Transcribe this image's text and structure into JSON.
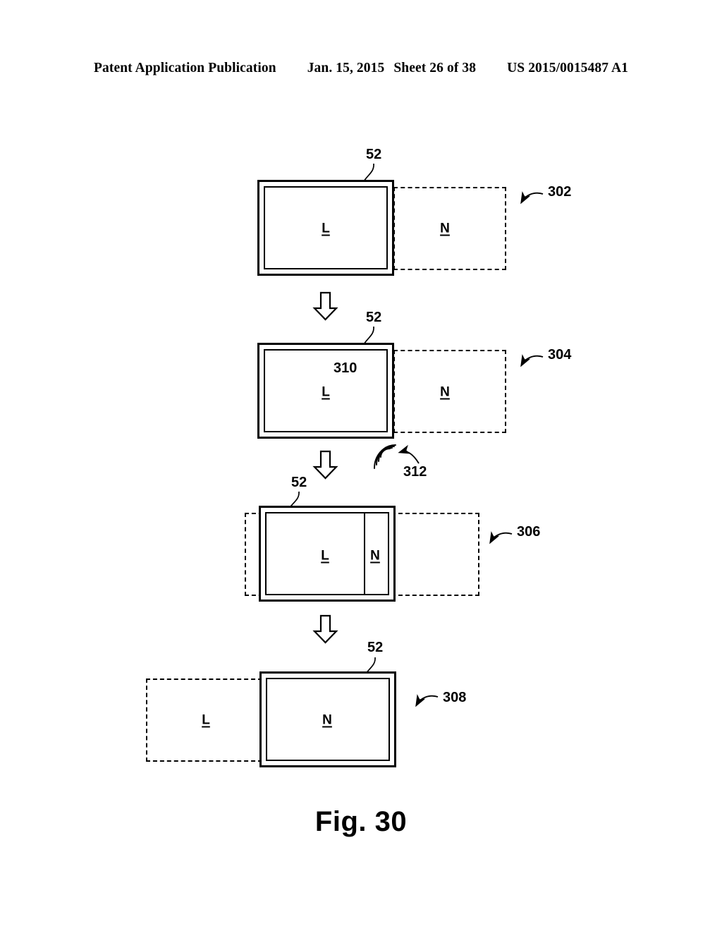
{
  "header": {
    "publication": "Patent Application Publication",
    "date": "Jan. 15, 2015",
    "sheet": "Sheet 26 of 38",
    "patent_number": "US 2015/0015487 A1"
  },
  "figure": {
    "caption": "Fig. 30",
    "device_label": "52",
    "content_primary": "L",
    "content_secondary": "N",
    "colors": {
      "ink": "#000000",
      "paper": "#ffffff"
    }
  },
  "states": [
    {
      "id": "302",
      "label": "302",
      "device_ref": "52",
      "device_content": "L",
      "offscreen_content": "N",
      "offscreen_side": "right",
      "description": "Content L shown on device display; content N resides off-screen to the right"
    },
    {
      "id": "304",
      "label": "304",
      "device_ref": "52",
      "device_content": "L",
      "offscreen_content": "N",
      "offscreen_side": "right",
      "gesture_ref": "310",
      "gesture_label": "310",
      "gesture_icon": "right-block-arrow-icon",
      "signal_ref": "312",
      "signal_label": "312",
      "signal_icon": "wireless-waves-icon",
      "description": "Swipe gesture 310 performed on the display; wireless signal 312 emitted"
    },
    {
      "id": "306",
      "label": "306",
      "device_ref": "52",
      "device_content": "L",
      "strip_content": "N",
      "offscreen_side": "both",
      "description": "Transitional state: content N begins sliding in from the right edge"
    },
    {
      "id": "308",
      "label": "308",
      "device_ref": "52",
      "device_content": "N",
      "offscreen_content": "L",
      "offscreen_side": "left",
      "description": "Content N fully shown on device display; content L now off-screen to the left"
    }
  ],
  "flow_arrows": [
    {
      "name": "transition-302-to-304",
      "direction": "down"
    },
    {
      "name": "transition-304-to-306",
      "direction": "down"
    },
    {
      "name": "transition-306-to-308",
      "direction": "down"
    }
  ]
}
